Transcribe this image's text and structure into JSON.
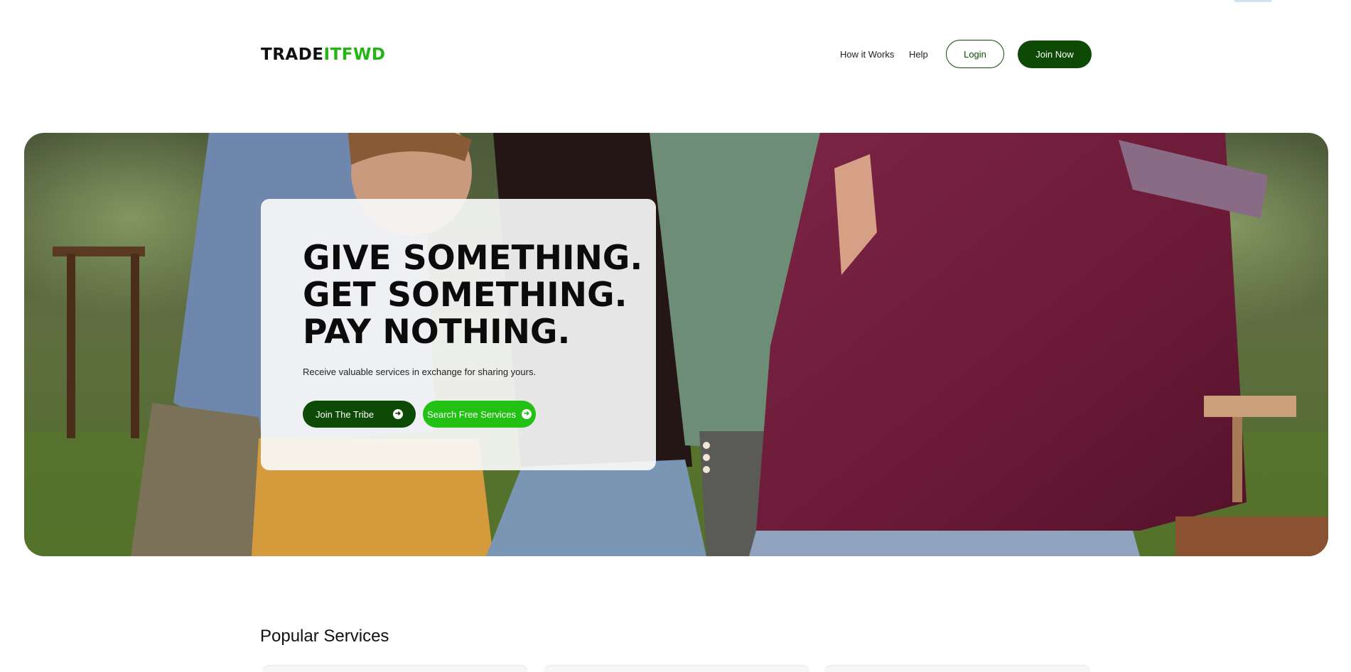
{
  "header": {
    "logo_part1": "TRADE",
    "logo_part2": "ITFWD",
    "nav": {
      "how_it_works": "How it Works",
      "help": "Help",
      "login": "Login",
      "join_now": "Join Now"
    }
  },
  "hero": {
    "title_lines": [
      "GIVE SOMETHING.",
      "GET SOMETHING.",
      "PAY NOTHING."
    ],
    "subtitle": "Receive valuable services in exchange for sharing yours.",
    "primary_button": "Join The Tribe",
    "secondary_button": "Search Free Services",
    "button_icon": "arrow-right-circle-icon"
  },
  "popular": {
    "title": "Popular Services"
  },
  "colors": {
    "brand_dark_green": "#0d4a05",
    "brand_green": "#22b514",
    "button_green": "#22c113"
  }
}
